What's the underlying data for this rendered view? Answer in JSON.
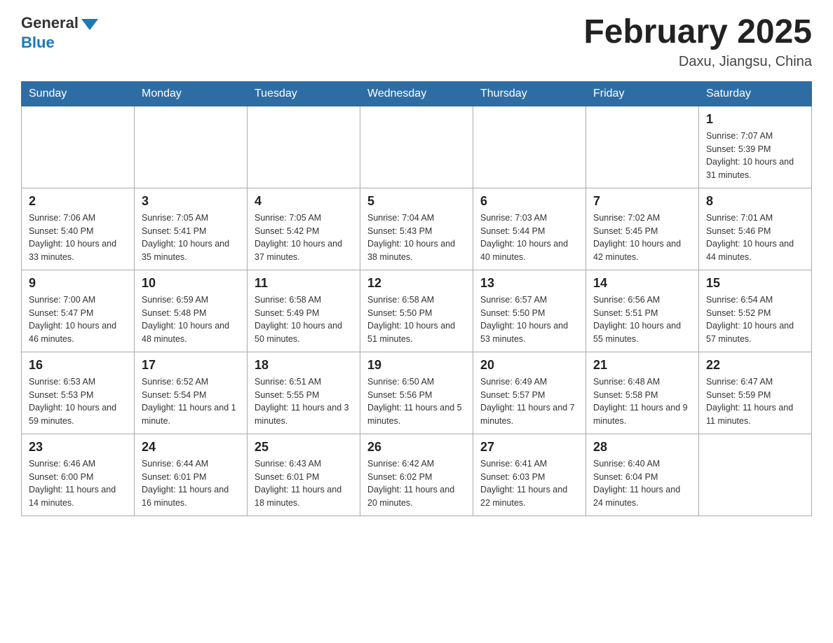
{
  "header": {
    "logo_general": "General",
    "logo_blue": "Blue",
    "title": "February 2025",
    "subtitle": "Daxu, Jiangsu, China"
  },
  "weekdays": [
    "Sunday",
    "Monday",
    "Tuesday",
    "Wednesday",
    "Thursday",
    "Friday",
    "Saturday"
  ],
  "weeks": [
    [
      {
        "day": "",
        "info": ""
      },
      {
        "day": "",
        "info": ""
      },
      {
        "day": "",
        "info": ""
      },
      {
        "day": "",
        "info": ""
      },
      {
        "day": "",
        "info": ""
      },
      {
        "day": "",
        "info": ""
      },
      {
        "day": "1",
        "info": "Sunrise: 7:07 AM\nSunset: 5:39 PM\nDaylight: 10 hours and 31 minutes."
      }
    ],
    [
      {
        "day": "2",
        "info": "Sunrise: 7:06 AM\nSunset: 5:40 PM\nDaylight: 10 hours and 33 minutes."
      },
      {
        "day": "3",
        "info": "Sunrise: 7:05 AM\nSunset: 5:41 PM\nDaylight: 10 hours and 35 minutes."
      },
      {
        "day": "4",
        "info": "Sunrise: 7:05 AM\nSunset: 5:42 PM\nDaylight: 10 hours and 37 minutes."
      },
      {
        "day": "5",
        "info": "Sunrise: 7:04 AM\nSunset: 5:43 PM\nDaylight: 10 hours and 38 minutes."
      },
      {
        "day": "6",
        "info": "Sunrise: 7:03 AM\nSunset: 5:44 PM\nDaylight: 10 hours and 40 minutes."
      },
      {
        "day": "7",
        "info": "Sunrise: 7:02 AM\nSunset: 5:45 PM\nDaylight: 10 hours and 42 minutes."
      },
      {
        "day": "8",
        "info": "Sunrise: 7:01 AM\nSunset: 5:46 PM\nDaylight: 10 hours and 44 minutes."
      }
    ],
    [
      {
        "day": "9",
        "info": "Sunrise: 7:00 AM\nSunset: 5:47 PM\nDaylight: 10 hours and 46 minutes."
      },
      {
        "day": "10",
        "info": "Sunrise: 6:59 AM\nSunset: 5:48 PM\nDaylight: 10 hours and 48 minutes."
      },
      {
        "day": "11",
        "info": "Sunrise: 6:58 AM\nSunset: 5:49 PM\nDaylight: 10 hours and 50 minutes."
      },
      {
        "day": "12",
        "info": "Sunrise: 6:58 AM\nSunset: 5:50 PM\nDaylight: 10 hours and 51 minutes."
      },
      {
        "day": "13",
        "info": "Sunrise: 6:57 AM\nSunset: 5:50 PM\nDaylight: 10 hours and 53 minutes."
      },
      {
        "day": "14",
        "info": "Sunrise: 6:56 AM\nSunset: 5:51 PM\nDaylight: 10 hours and 55 minutes."
      },
      {
        "day": "15",
        "info": "Sunrise: 6:54 AM\nSunset: 5:52 PM\nDaylight: 10 hours and 57 minutes."
      }
    ],
    [
      {
        "day": "16",
        "info": "Sunrise: 6:53 AM\nSunset: 5:53 PM\nDaylight: 10 hours and 59 minutes."
      },
      {
        "day": "17",
        "info": "Sunrise: 6:52 AM\nSunset: 5:54 PM\nDaylight: 11 hours and 1 minute."
      },
      {
        "day": "18",
        "info": "Sunrise: 6:51 AM\nSunset: 5:55 PM\nDaylight: 11 hours and 3 minutes."
      },
      {
        "day": "19",
        "info": "Sunrise: 6:50 AM\nSunset: 5:56 PM\nDaylight: 11 hours and 5 minutes."
      },
      {
        "day": "20",
        "info": "Sunrise: 6:49 AM\nSunset: 5:57 PM\nDaylight: 11 hours and 7 minutes."
      },
      {
        "day": "21",
        "info": "Sunrise: 6:48 AM\nSunset: 5:58 PM\nDaylight: 11 hours and 9 minutes."
      },
      {
        "day": "22",
        "info": "Sunrise: 6:47 AM\nSunset: 5:59 PM\nDaylight: 11 hours and 11 minutes."
      }
    ],
    [
      {
        "day": "23",
        "info": "Sunrise: 6:46 AM\nSunset: 6:00 PM\nDaylight: 11 hours and 14 minutes."
      },
      {
        "day": "24",
        "info": "Sunrise: 6:44 AM\nSunset: 6:01 PM\nDaylight: 11 hours and 16 minutes."
      },
      {
        "day": "25",
        "info": "Sunrise: 6:43 AM\nSunset: 6:01 PM\nDaylight: 11 hours and 18 minutes."
      },
      {
        "day": "26",
        "info": "Sunrise: 6:42 AM\nSunset: 6:02 PM\nDaylight: 11 hours and 20 minutes."
      },
      {
        "day": "27",
        "info": "Sunrise: 6:41 AM\nSunset: 6:03 PM\nDaylight: 11 hours and 22 minutes."
      },
      {
        "day": "28",
        "info": "Sunrise: 6:40 AM\nSunset: 6:04 PM\nDaylight: 11 hours and 24 minutes."
      },
      {
        "day": "",
        "info": ""
      }
    ]
  ]
}
